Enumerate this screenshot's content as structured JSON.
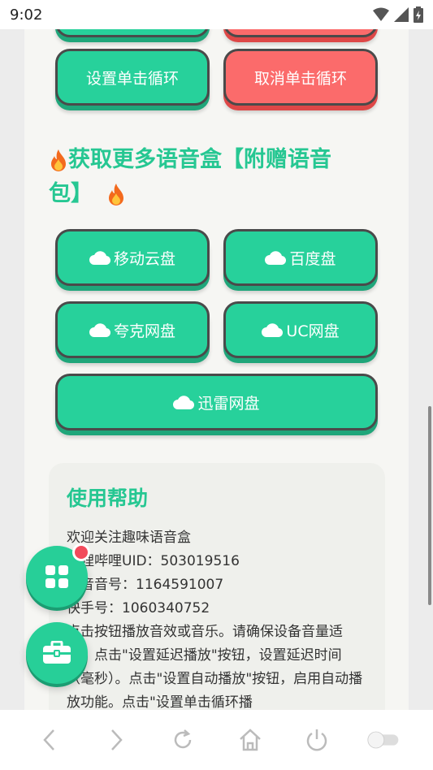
{
  "status_bar": {
    "time": "9:02"
  },
  "buttons": {
    "set_click_loop": "设置单击循环",
    "cancel_click_loop": "取消单击循环"
  },
  "more_section": {
    "title_part1": "获取更多语音盒【附赠语音",
    "title_part2": "包】",
    "cloud_links": [
      "移动云盘",
      "百度盘",
      "夸克网盘",
      "UC网盘",
      "迅雷网盘"
    ]
  },
  "help": {
    "title": "使用帮助",
    "line1": "欢迎关注趣味语音盒",
    "line2": "哔哩哔哩UID：503019516",
    "line3": "抖音音号：1164591007",
    "line4": "快手号：1060340752",
    "paragraph": "点击按钮播放音效或音乐。请确保设备音量适中。点击\"设置延迟播放\"按钮，设置延迟时间（毫秒）。点击\"设置自动播放\"按钮，启用自动播放功能。点击\"设置单击循环播"
  },
  "icons": {
    "cloud": "cloud-icon",
    "fire": "fire-icon",
    "grid": "grid-icon",
    "toolbox": "toolbox-icon"
  },
  "colors": {
    "accent_green": "#27d19b",
    "accent_red": "#fb6b6b",
    "title_green": "#26c792",
    "badge_red": "#f24b5c"
  }
}
